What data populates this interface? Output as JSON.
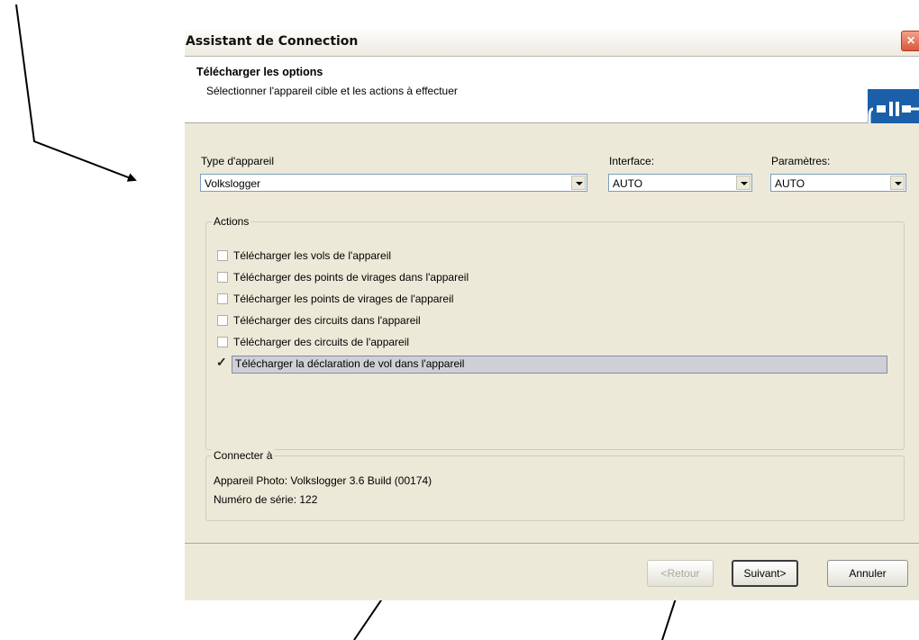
{
  "window": {
    "title": "Assistant de Connection",
    "close": "✕"
  },
  "header": {
    "title": "Télécharger les options",
    "subtitle": "Sélectionner l'appareil cible et les actions à effectuer"
  },
  "device": {
    "label": "Type d'appareil",
    "value": "Volkslogger"
  },
  "interface": {
    "label": "Interface:",
    "value": "AUTO"
  },
  "params": {
    "label": "Paramètres:",
    "value": "AUTO"
  },
  "actions": {
    "legend": "Actions",
    "items": [
      {
        "label": "Télécharger les vols de l'appareil",
        "checked": false
      },
      {
        "label": "Télécharger des points de virages  dans l'appareil",
        "checked": false
      },
      {
        "label": "Télécharger les points de virages de l'appareil",
        "checked": false
      },
      {
        "label": "Télécharger des circuits dans l'appareil",
        "checked": false
      },
      {
        "label": "Télécharger des circuits de l'appareil",
        "checked": false
      },
      {
        "label": "Télécharger  la déclaration de vol dans l'appareil",
        "checked": true
      }
    ]
  },
  "connect": {
    "legend": "Connecter à",
    "line1": "Appareil Photo: Volkslogger 3.6 Build (00174)",
    "line2": "Numéro de série: 122"
  },
  "buttons": {
    "back": "<Retour",
    "next": "Suivant>",
    "cancel": "Annuler"
  },
  "colors": {
    "accent": "#1a5fa8",
    "dialog_bg": "#ece9d8",
    "close": "#d9583a"
  }
}
